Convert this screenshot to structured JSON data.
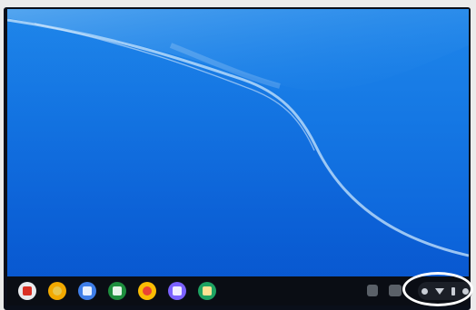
{
  "wallpaper": {
    "colors": {
      "top": "#1f86ea",
      "bottom": "#0a5fd8",
      "wave": "#bfe0fb"
    }
  },
  "shelf": {
    "apps": [
      {
        "name": "gmail-icon",
        "bg": "#e8eaed",
        "fg": "#d93025"
      },
      {
        "name": "chrome-icon",
        "bg": "#f2a900",
        "fg": "#e8c64c"
      },
      {
        "name": "docs-icon",
        "bg": "#3f7ee8",
        "fg": "#e8f0fe"
      },
      {
        "name": "sheets-icon",
        "bg": "#1e8e3e",
        "fg": "#e6f4ea"
      },
      {
        "name": "photos-icon",
        "bg": "#fbbc04",
        "fg": "#ea4335"
      },
      {
        "name": "slides-icon",
        "bg": "#7b61ff",
        "fg": "#f1ecff"
      },
      {
        "name": "classroom-icon",
        "bg": "#1ea362",
        "fg": "#fde293"
      }
    ],
    "status_tray_icons": [
      "notification-icon",
      "wifi-icon",
      "battery-icon",
      "time-icon"
    ],
    "highlight_color": "#ffffff"
  }
}
